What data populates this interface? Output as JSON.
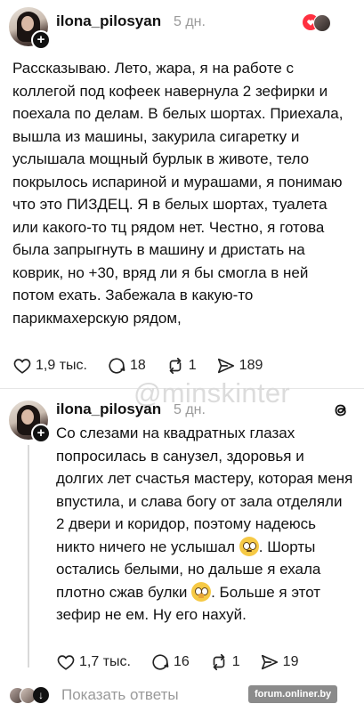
{
  "post1": {
    "username": "ilona_pilosyan",
    "time": "5 дн.",
    "text": "Рассказываю. Лето, жара, я на работе с коллегой под кофеек навернула 2 зефирки и поехала по делам. В белых шортах. Приехала, вышла из машины, закурила сигаретку и услышала мощный бурлык в животе, тело покрылось испариной и мурашами, я понимаю что это ПИЗДЕЦ. Я в белых шортах, туалета или какого-то тц рядом нет. Честно, я готова была запрыгнуть в машину и дристать на коврик, но +30, вряд ли я бы смогла в ней потом ехать. Забежала в какую-то парикмахерскую рядом,",
    "likes": "1,9 тыс.",
    "comments": "18",
    "reposts": "1",
    "shares": "189"
  },
  "post2": {
    "username": "ilona_pilosyan",
    "time": "5 дн.",
    "text_a": "Со слезами на квадратных глазах попросилась в санузел, здоровья и долгих лет счастья мастеру, которая меня впустила, и слава богу от зала отделяли 2 двери и коридор, поэтому надеюсь никто ничего не услышал",
    "text_b": ". Шорты остались белыми, но дальше я ехала плотно сжав булки",
    "text_c": ". Больше я этот зефир не ем. Ну его нахуй.",
    "likes": "1,7 тыс.",
    "comments": "16",
    "reposts": "1",
    "shares": "19"
  },
  "watermark": "@minskinter",
  "footer": {
    "show_replies": "Показать ответы",
    "badge": "forum.onliner.by"
  },
  "colors": {
    "like_badge": "#ff3040",
    "text": "#111111",
    "muted": "#9a9a9a"
  }
}
